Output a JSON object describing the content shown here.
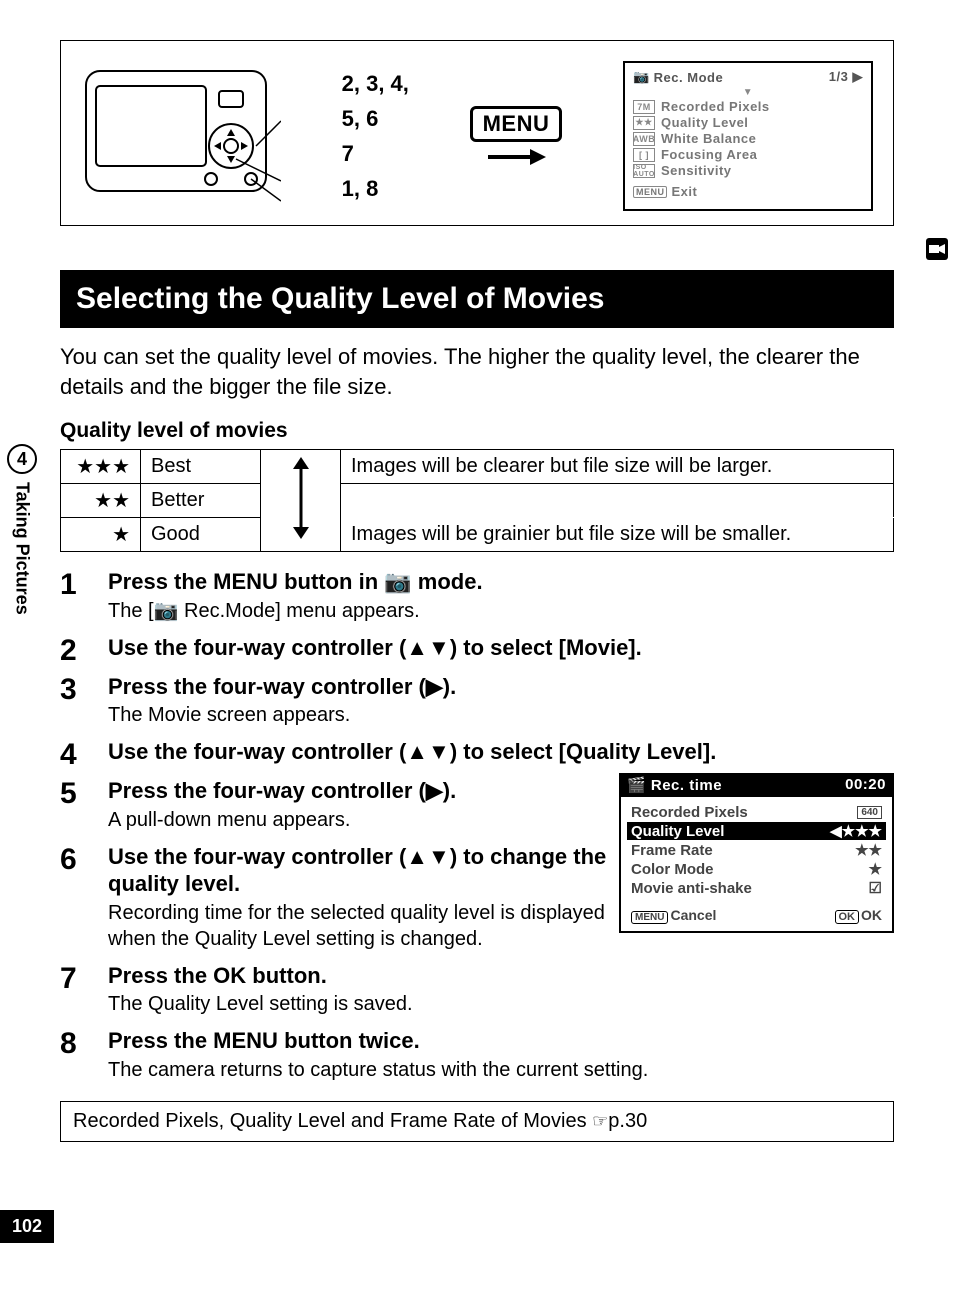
{
  "sideTab": {
    "chapterNum": "4",
    "chapterLabel": "Taking Pictures"
  },
  "pageNumber": "102",
  "diagram": {
    "callout1": "2, 3, 4,",
    "callout2": "5, 6",
    "callout3": "7",
    "callout4": "1, 8",
    "menuLabel": "MENU",
    "lcd": {
      "title": "Rec. Mode",
      "page": "1/3",
      "items": [
        {
          "icon": "7M",
          "label": "Recorded Pixels"
        },
        {
          "icon": "★★",
          "label": "Quality Level"
        },
        {
          "icon": "AWB",
          "label": "White Balance"
        },
        {
          "icon": "[ ]",
          "label": "Focusing Area"
        },
        {
          "icon": "ISO AUTO",
          "label": "Sensitivity"
        }
      ],
      "exit": "Exit",
      "menuTag": "MENU"
    }
  },
  "heading": "Selecting the Quality Level of Movies",
  "intro": "You can set the quality level of movies. The higher the quality level, the clearer the details and the bigger the file size.",
  "tableHeading": "Quality level of movies",
  "qtable": {
    "rows": [
      {
        "stars": "★★★",
        "word": "Best"
      },
      {
        "stars": "★★",
        "word": "Better"
      },
      {
        "stars": "★",
        "word": "Good"
      }
    ],
    "descTop": "Images will be clearer but file size will be larger.",
    "descBottom": "Images will be grainier but file size will be smaller."
  },
  "steps": {
    "s1": {
      "title_a": "Press the ",
      "title_b": "MENU",
      "title_c": " button in ",
      "title_d": " mode.",
      "note": "The [📷 Rec.Mode] menu appears."
    },
    "s2": {
      "title": "Use the four-way controller (▲▼) to select [Movie]."
    },
    "s3": {
      "title": "Press the four-way controller (▶).",
      "note": "The Movie screen appears."
    },
    "s4": {
      "title": "Use the four-way controller (▲▼) to select [Quality Level]."
    },
    "s5": {
      "title": "Press the four-way controller (▶).",
      "note": "A pull-down menu appears."
    },
    "s6": {
      "title": "Use the four-way controller (▲▼) to change the quality level.",
      "note": "Recording time for the selected quality level is displayed when the Quality Level setting is changed."
    },
    "s7": {
      "title_a": "Press the ",
      "title_b": "OK",
      "title_c": " button.",
      "note": "The Quality Level setting is saved."
    },
    "s8": {
      "title_a": "Press the ",
      "title_b": "MENU",
      "title_c": " button twice.",
      "note": "The camera returns to capture status with the current setting."
    }
  },
  "miniLcd": {
    "title": "Rec. time",
    "time": "00:20",
    "rows": {
      "recordedPixels": "Recorded Pixels",
      "recordedPixelsVal": "640",
      "qualityLevel": "Quality Level",
      "qualityLevelVal": "★★★",
      "frameRate": "Frame Rate",
      "frameRateSub1": "★★",
      "colorMode": "Color Mode",
      "colorModeSub": "★",
      "antiShake": "Movie anti-shake",
      "antiShakeVal": "☑"
    },
    "cancel": "Cancel",
    "ok": "OK",
    "okTag": "OK",
    "menuTag": "MENU"
  },
  "xref": {
    "text": "Recorded Pixels, Quality Level and Frame Rate of Movies ",
    "page": "p.30"
  },
  "stepNums": {
    "n1": "1",
    "n2": "2",
    "n3": "3",
    "n4": "4",
    "n5": "5",
    "n6": "6",
    "n7": "7",
    "n8": "8"
  }
}
